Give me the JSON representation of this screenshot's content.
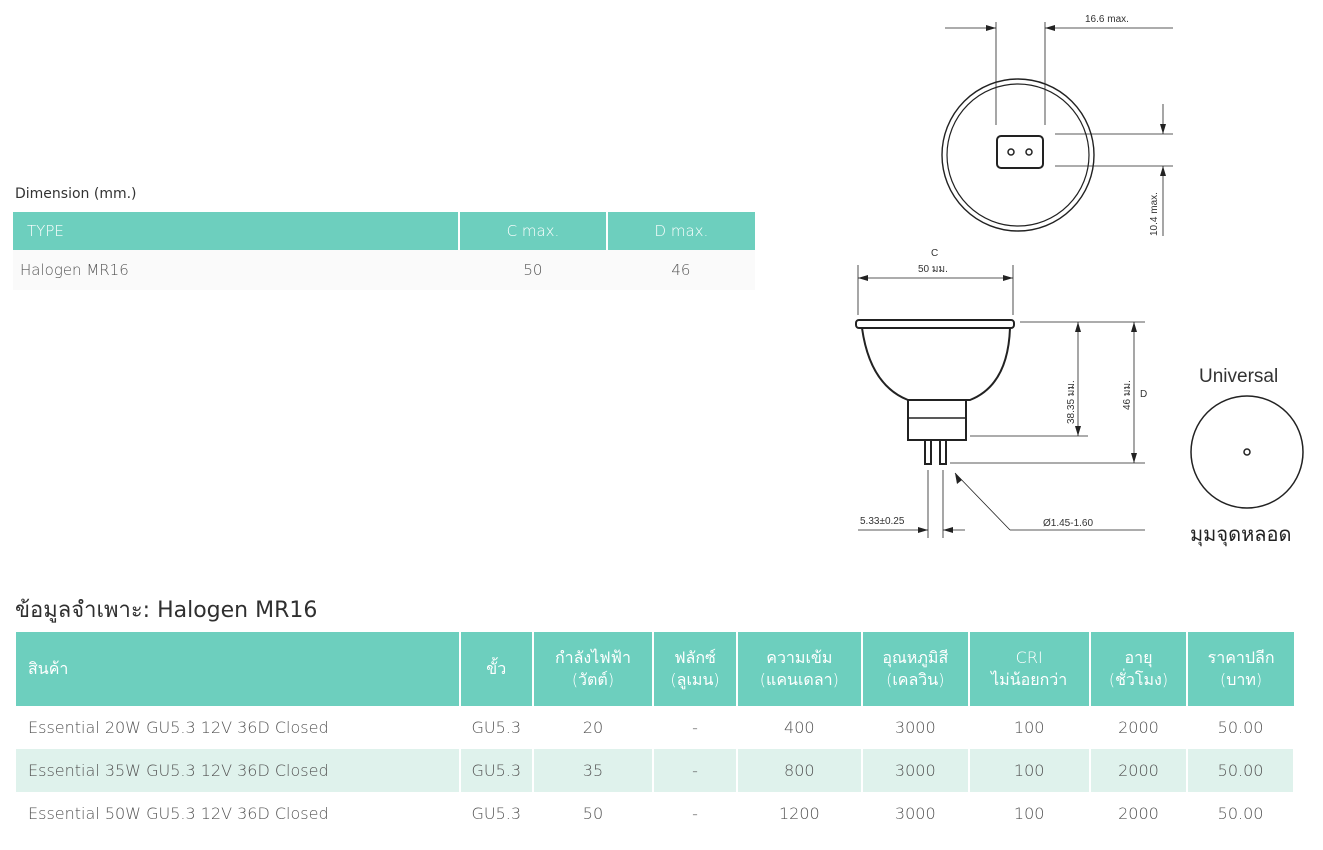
{
  "dimension": {
    "label": "Dimension (mm.)",
    "headers": [
      "TYPE",
      "C max.",
      "D max."
    ],
    "rows": [
      [
        "Halogen MR16",
        "50",
        "46"
      ]
    ]
  },
  "spec": {
    "title": "ข้อมูลจำเพาะ: Halogen MR16",
    "headers": [
      [
        "สินค้า",
        ""
      ],
      [
        "ขั้ว",
        ""
      ],
      [
        "กำลังไฟฟ้า",
        "(วัตต์)"
      ],
      [
        "ฟลักซ์",
        "(ลูเมน)"
      ],
      [
        "ความเข้ม",
        "(แคนเดลา)"
      ],
      [
        "อุณหภูมิสี",
        "(เคลวิน)"
      ],
      [
        "CRI",
        "ไม่น้อยกว่า"
      ],
      [
        "อายุ",
        "(ชั่วโมง)"
      ],
      [
        "ราคาปลีก",
        "(บาท)"
      ]
    ],
    "rows": [
      [
        "Essential 20W GU5.3 12V 36D Closed",
        "GU5.3",
        "20",
        "-",
        "400",
        "3000",
        "100",
        "2000",
        "50.00"
      ],
      [
        "Essential 35W GU5.3 12V 36D Closed",
        "GU5.3",
        "35",
        "-",
        "800",
        "3000",
        "100",
        "2000",
        "50.00"
      ],
      [
        "Essential 50W GU5.3 12V 36D Closed",
        "GU5.3",
        "50",
        "-",
        "1200",
        "3000",
        "100",
        "2000",
        "50.00"
      ]
    ]
  },
  "drawing": {
    "pin_spacing": "16.6 max.",
    "pin_height": "10.4 max.",
    "c_label": "C",
    "c_value": "50 มม.",
    "reflector_height": "38.35 มม.",
    "total_height": "46 มม.",
    "d_label": "D",
    "pin_pitch": "5.33±0.25",
    "pin_diameter": "Ø1.45-1.60",
    "universal": "Universal",
    "beam_angle_label": "มุมจุดหลอด"
  },
  "colors": {
    "header_bg": "#6dcfbe",
    "stripe_bg": "#dff2ec"
  }
}
